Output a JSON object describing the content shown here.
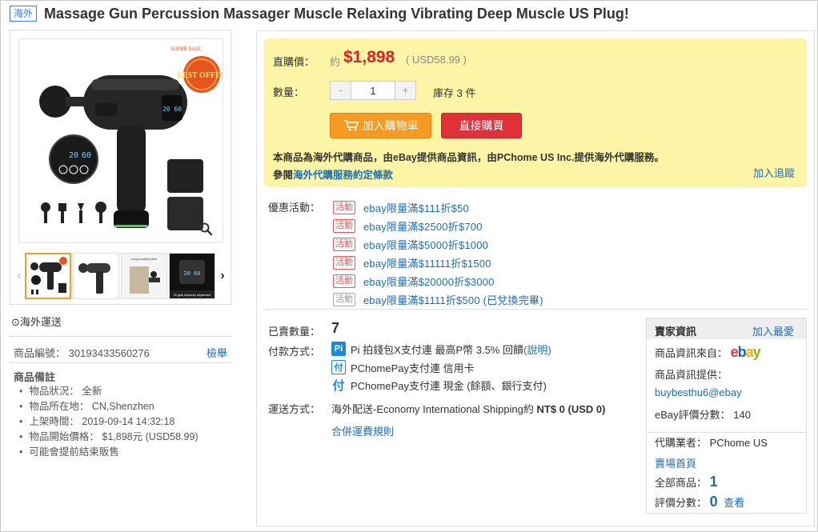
{
  "header": {
    "badge": "海外",
    "title": "Massage Gun Percussion Massager Muscle Relaxing Vibrating Deep Muscle US Plug!"
  },
  "gallery": {
    "main_image": {
      "promo_top": "SUPER SALE",
      "promo_badge": "BEST OFFER",
      "display_left": "20",
      "display_right": "60"
    },
    "thumbs": [
      {
        "name": "thumb-1"
      },
      {
        "name": "thumb-2"
      },
      {
        "name": "thumb-3",
        "caption": "Long working time"
      },
      {
        "name": "thumb-4",
        "caption": "20 gear frequency adjustment"
      }
    ]
  },
  "sidebar": {
    "shipping": "海外運送",
    "product_id_label": "商品編號：",
    "product_id": "30193433560276",
    "report_link": "檢舉",
    "notes_title": "商品備註",
    "notes": [
      "物品狀況： 全新",
      "物品所在地： CN,Shenzhen",
      "上架時間： 2019-09-14 14:32:18",
      "物品開始價格： $1,898元 (USD58.99)",
      "可能會提前結束販售"
    ]
  },
  "buy": {
    "price_label": "直購價：",
    "about": "約",
    "price": "$1,898",
    "price_usd": "( USD58.99 )",
    "qty_label": "數量：",
    "qty_value": "1",
    "qty_minus": "-",
    "qty_plus": "+",
    "stock": "庫存 3 件",
    "add_to_cart": "加入購物車",
    "buy_now": "直接購買",
    "note": "本商品為海外代購商品，由eBay提供商品資訊，由PChome US Inc.提供海外代購服務。",
    "terms_prefix": "參閱",
    "terms_link": "海外代購服務約定條款",
    "track": "加入追蹤"
  },
  "promos": {
    "label": "優惠活動：",
    "items": [
      {
        "tag": "活動",
        "text": "ebay限量滿$111折$50",
        "used": false
      },
      {
        "tag": "活動",
        "text": "ebay限量滿$2500折$700",
        "used": false
      },
      {
        "tag": "活動",
        "text": "ebay限量滿$5000折$1000",
        "used": false
      },
      {
        "tag": "活動",
        "text": "ebay限量滿$11111折$1500",
        "used": false
      },
      {
        "tag": "活動",
        "text": "ebay限量滿$20000折$3000",
        "used": false
      },
      {
        "tag": "活動",
        "text": "ebay限量滿$1111折$500 (已兌換完畢)",
        "used": true
      }
    ]
  },
  "details": {
    "sold_label": "已賣數量：",
    "sold": "7",
    "pay_label": "付款方式：",
    "pay_pi_icon": "Pi",
    "pay_pi": "Pi 拍錢包X支付連   最高P幣 3.5% 回饋",
    "pay_pi_link": "(說明)",
    "pay_card_icon": "付",
    "pay_card": "PChomePay支付連 信用卡",
    "pay_cash_icon": "付",
    "pay_cash": "PChomePay支付連 現金 (餘額、銀行支付)",
    "ship_label": "運送方式：",
    "ship_text": "海外配送-Economy International Shipping約 ",
    "ship_price": "NT$ 0 (USD 0)",
    "ship_link": "合併運費規則"
  },
  "seller": {
    "title": "賣家資訊",
    "fav": "加入最愛",
    "source_label": "商品資訊來自：",
    "ebay_e": "e",
    "ebay_b": "b",
    "ebay_a": "a",
    "ebay_y": "y",
    "provider_label": "商品資訊提供：",
    "provider": "buybesthu6@ebay",
    "score_label": "eBay評價分數：",
    "score": "140",
    "agent_label": "代購業者：",
    "agent": "PChome US",
    "store_link": "賣場首頁",
    "all_label": "全部商品：",
    "all_count": "1",
    "rating_label": "評價分數：",
    "rating": "0",
    "view_link": "查看"
  }
}
